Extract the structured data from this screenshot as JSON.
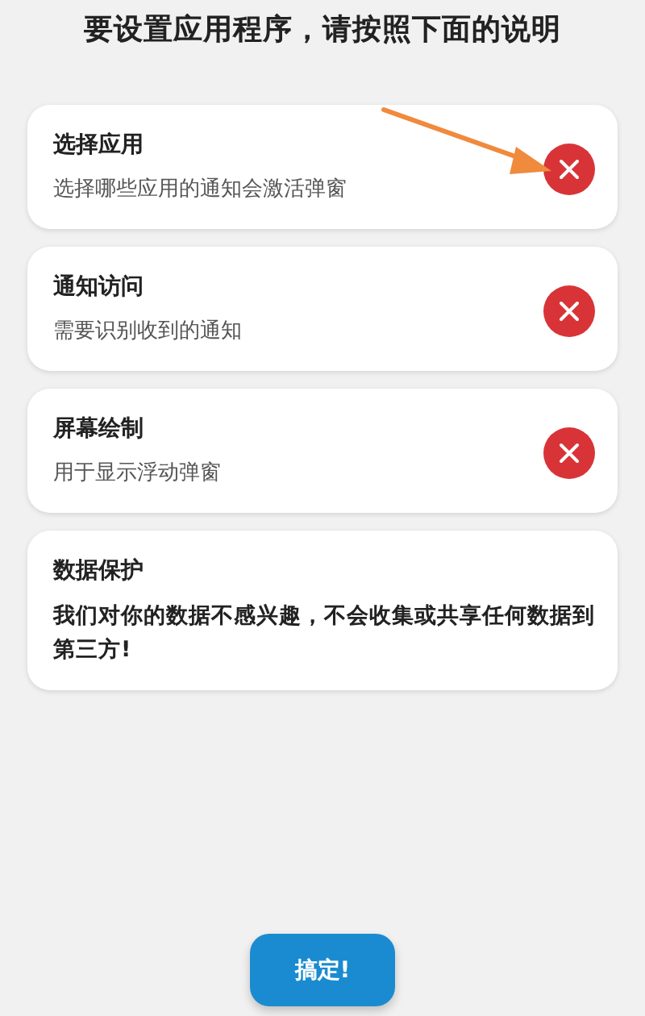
{
  "title": "要设置应用程序，请按照下面的说明",
  "cards": [
    {
      "kind": "permission",
      "title": "选择应用",
      "description": "选择哪些应用的通知会激活弹窗",
      "granted": false
    },
    {
      "kind": "permission",
      "title": "通知访问",
      "description": "需要识别收到的通知",
      "granted": false
    },
    {
      "kind": "permission",
      "title": "屏幕绘制",
      "description": "用于显示浮动弹窗",
      "granted": false
    },
    {
      "kind": "info",
      "title": "数据保护",
      "description": "我们对你的数据不感兴趣，不会收集或共享任何数据到第三方!"
    }
  ],
  "button": "搞定!"
}
